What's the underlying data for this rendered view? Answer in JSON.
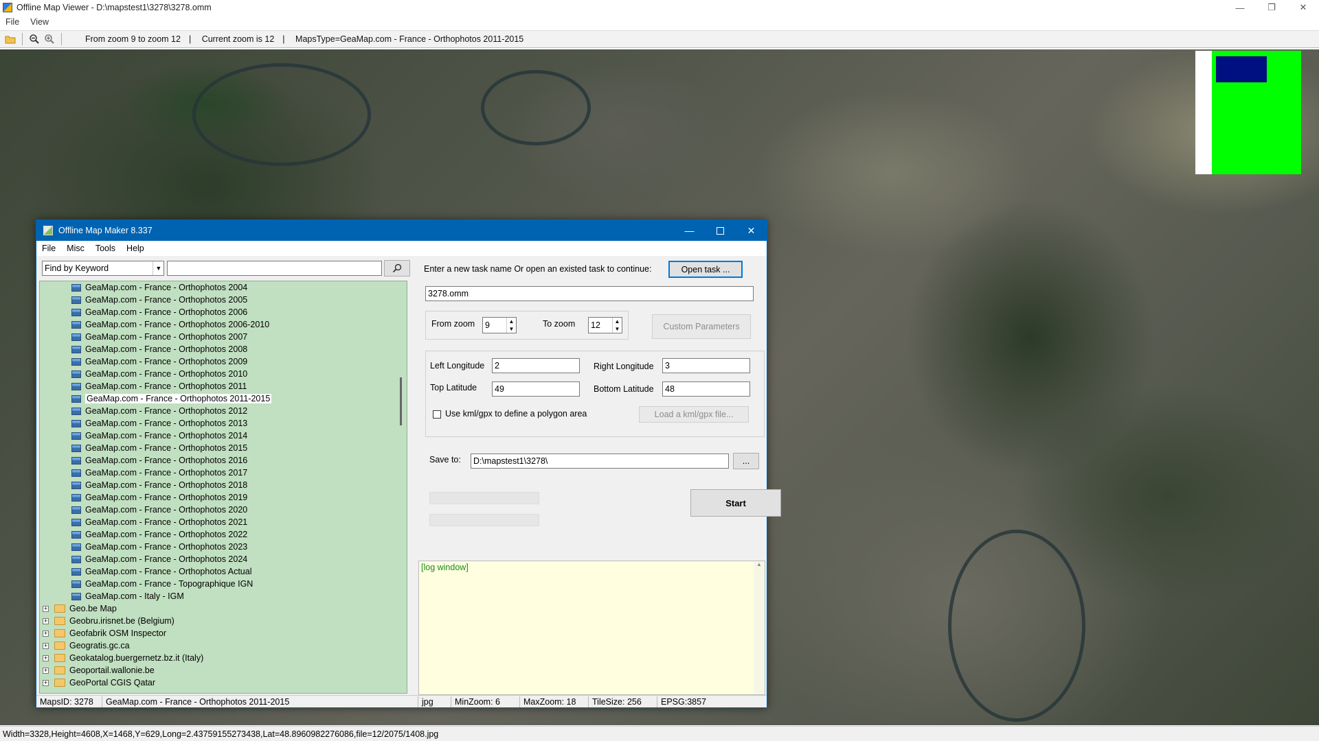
{
  "window": {
    "title": "Offline Map Viewer - D:\\mapstest1\\3278\\3278.omm",
    "controls": [
      "—",
      "❐",
      "✕"
    ]
  },
  "menubar": {
    "items": [
      "File",
      "View"
    ]
  },
  "toolbar": {
    "zoom_range": "From zoom 9 to zoom 12",
    "current_zoom": "Current zoom is 12",
    "maps_type": "MapsType=GeaMap.com - France - Orthophotos 2011-2015",
    "sep": "|"
  },
  "statusbar": {
    "text": "Width=3328,Height=4608,X=1468,Y=629,Long=2.43759155273438,Lat=48.8960982276086,file=12/2075/1408.jpg"
  },
  "dialog": {
    "title": "Offline Map Maker 8.337",
    "menu": [
      "File",
      "Misc",
      "Tools",
      "Help"
    ],
    "find": {
      "mode": "Find by Keyword",
      "query": ""
    },
    "tree": {
      "leaves": [
        "GeaMap.com - France - Orthophotos 2004",
        "GeaMap.com - France - Orthophotos 2005",
        "GeaMap.com - France - Orthophotos 2006",
        "GeaMap.com - France - Orthophotos 2006-2010",
        "GeaMap.com - France - Orthophotos 2007",
        "GeaMap.com - France - Orthophotos 2008",
        "GeaMap.com - France - Orthophotos 2009",
        "GeaMap.com - France - Orthophotos 2010",
        "GeaMap.com - France - Orthophotos 2011",
        "GeaMap.com - France - Orthophotos 2011-2015",
        "GeaMap.com - France - Orthophotos 2012",
        "GeaMap.com - France - Orthophotos 2013",
        "GeaMap.com - France - Orthophotos 2014",
        "GeaMap.com - France - Orthophotos 2015",
        "GeaMap.com - France - Orthophotos 2016",
        "GeaMap.com - France - Orthophotos 2017",
        "GeaMap.com - France - Orthophotos 2018",
        "GeaMap.com - France - Orthophotos 2019",
        "GeaMap.com - France - Orthophotos 2020",
        "GeaMap.com - France - Orthophotos 2021",
        "GeaMap.com - France - Orthophotos 2022",
        "GeaMap.com - France - Orthophotos 2023",
        "GeaMap.com - France - Orthophotos 2024",
        "GeaMap.com - France - Orthophotos Actual",
        "GeaMap.com - France - Topographique IGN",
        "GeaMap.com - Italy - IGM"
      ],
      "selected": "GeaMap.com - France - Orthophotos 2011-2015",
      "folders": [
        "Geo.be Map",
        "Geobru.irisnet.be (Belgium)",
        "Geofabrik OSM Inspector",
        "Geogratis.gc.ca",
        "Geokatalog.buergernetz.bz.it (Italy)",
        "Geoportail.wallonie.be",
        "GeoPortal CGIS Qatar"
      ]
    },
    "task": {
      "prompt": "Enter a new task name Or open an existed task to continue:",
      "open_button": "Open task ...",
      "name": "3278.omm"
    },
    "zoom": {
      "from_label": "From zoom",
      "from_value": "9",
      "to_label": "To zoom",
      "to_value": "12",
      "custom_button": "Custom Parameters"
    },
    "coords": {
      "left_lon_label": "Left Longitude",
      "left_lon": "2",
      "right_lon_label": "Right Longitude",
      "right_lon": "3",
      "top_lat_label": "Top Latitude",
      "top_lat": "49",
      "bottom_lat_label": "Bottom Latitude",
      "bottom_lat": "48",
      "kml_label": "Use kml/gpx to define a polygon area",
      "kml_button": "Load a kml/gpx file..."
    },
    "save": {
      "label": "Save to:",
      "path": "D:\\mapstest1\\3278\\",
      "browse": "..."
    },
    "start_button": "Start",
    "log": {
      "text": "[log window]"
    },
    "status": {
      "maps_id": "MapsID: 3278",
      "maps_name": "GeaMap.com - France - Orthophotos 2011-2015",
      "format": "jpg",
      "min_zoom": "MinZoom: 6",
      "max_zoom": "MaxZoom: 18",
      "tile_size": "TileSize: 256",
      "epsg": "EPSG:3857"
    }
  },
  "colors": {
    "title_bar": "#0063b1",
    "tree_bg": "#c1dfc1",
    "log_bg": "#ffffe0",
    "log_text": "#1a8a1a",
    "overview_green": "#00ff00",
    "overview_blue": "#001080"
  }
}
